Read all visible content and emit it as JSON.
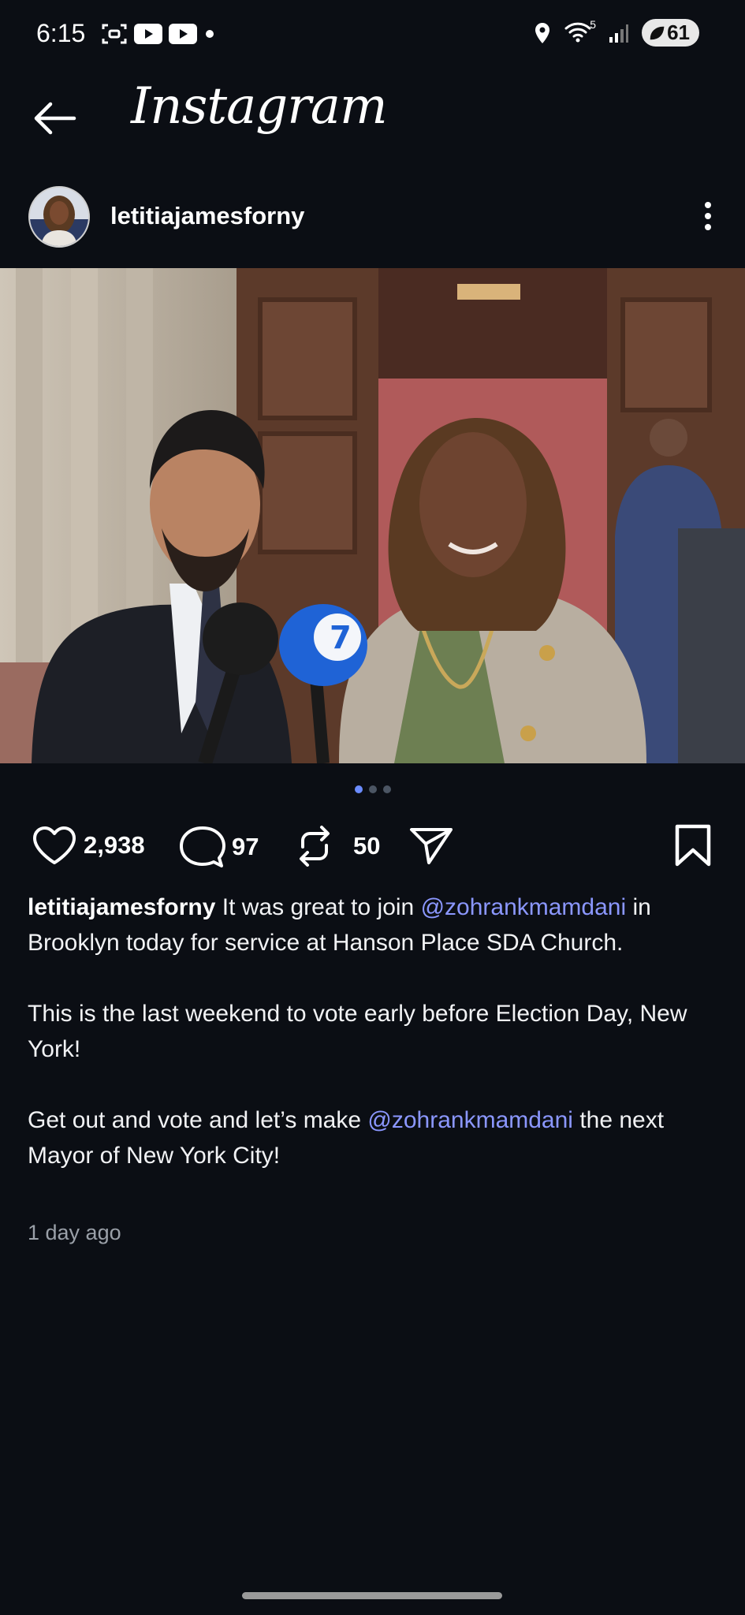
{
  "status_bar": {
    "time": "6:15",
    "wifi_badge": "5",
    "battery": "61"
  },
  "app": {
    "title": "Instagram"
  },
  "post": {
    "username": "letitiajamesforny",
    "likes": "2,938",
    "comments": "97",
    "reposts": "50",
    "caption_p1_a": "It was great to join",
    "mention": "@zohrankmamdani",
    "caption_p1_b": "in Brooklyn today for service at Hanson Place SDA Church.",
    "caption_p2": "This is the last weekend to vote early before Election Day, New York!",
    "caption_p3_a": "Get out and vote and let’s make",
    "caption_p3_b": "the next Mayor of New York City!",
    "time_ago": "1 day ago",
    "carousel_count": 3,
    "carousel_active": 1
  },
  "colors": {
    "background": "#0b0e14",
    "mention": "#8b97ff",
    "dot_active": "#6b8cff"
  }
}
